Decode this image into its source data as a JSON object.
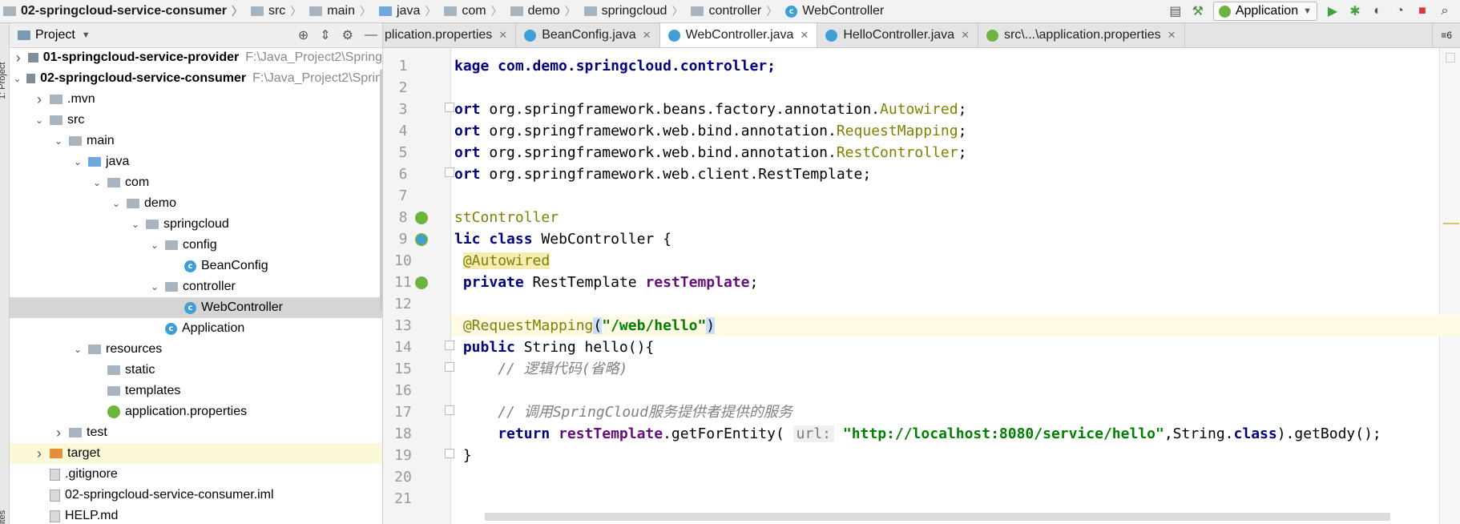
{
  "breadcrumb": [
    "02-springcloud-service-consumer",
    "src",
    "main",
    "java",
    "com",
    "demo",
    "springcloud",
    "controller",
    "WebController"
  ],
  "run_config": {
    "label": "Application"
  },
  "left_strip": {
    "top_label": "1: Project",
    "bottom_label": "ites"
  },
  "project_panel": {
    "title": "Project",
    "tree": [
      {
        "label": "01-springcloud-service-provider",
        "path": "F:\\Java_Project2\\Spring",
        "bold": true,
        "depth": 0,
        "arrow": "right",
        "icon": "module"
      },
      {
        "label": "02-springcloud-service-consumer",
        "path": "F:\\Java_Project2\\Sprin",
        "bold": true,
        "depth": 0,
        "arrow": "down",
        "icon": "module"
      },
      {
        "label": ".mvn",
        "depth": 1,
        "arrow": "right",
        "icon": "folder"
      },
      {
        "label": "src",
        "depth": 1,
        "arrow": "down",
        "icon": "folder"
      },
      {
        "label": "main",
        "depth": 2,
        "arrow": "down",
        "icon": "folder"
      },
      {
        "label": "java",
        "depth": 3,
        "arrow": "down",
        "icon": "folder-blue"
      },
      {
        "label": "com",
        "depth": 4,
        "arrow": "down",
        "icon": "folder"
      },
      {
        "label": "demo",
        "depth": 5,
        "arrow": "down",
        "icon": "folder"
      },
      {
        "label": "springcloud",
        "depth": 6,
        "arrow": "down",
        "icon": "folder"
      },
      {
        "label": "config",
        "depth": 7,
        "arrow": "down",
        "icon": "folder"
      },
      {
        "label": "BeanConfig",
        "depth": 8,
        "arrow": "",
        "icon": "class"
      },
      {
        "label": "controller",
        "depth": 7,
        "arrow": "down",
        "icon": "folder"
      },
      {
        "label": "WebController",
        "depth": 8,
        "arrow": "",
        "icon": "class",
        "selected": true
      },
      {
        "label": "Application",
        "depth": 7,
        "arrow": "",
        "icon": "class"
      },
      {
        "label": "resources",
        "depth": 3,
        "arrow": "down",
        "icon": "folder"
      },
      {
        "label": "static",
        "depth": 4,
        "arrow": "",
        "icon": "folder"
      },
      {
        "label": "templates",
        "depth": 4,
        "arrow": "",
        "icon": "folder"
      },
      {
        "label": "application.properties",
        "depth": 4,
        "arrow": "",
        "icon": "spring"
      },
      {
        "label": "test",
        "depth": 2,
        "arrow": "right",
        "icon": "folder"
      },
      {
        "label": "target",
        "depth": 1,
        "arrow": "right",
        "icon": "folder-orange",
        "highlight": true
      },
      {
        "label": ".gitignore",
        "depth": 1,
        "arrow": "",
        "icon": "file"
      },
      {
        "label": "02-springcloud-service-consumer.iml",
        "depth": 1,
        "arrow": "",
        "icon": "file"
      },
      {
        "label": "HELP.md",
        "depth": 1,
        "arrow": "",
        "icon": "file"
      }
    ]
  },
  "tabs": [
    {
      "label": "plication.properties",
      "icon": "leaf",
      "active": false
    },
    {
      "label": "BeanConfig.java",
      "icon": "class",
      "active": false
    },
    {
      "label": "WebController.java",
      "icon": "class",
      "active": true
    },
    {
      "label": "HelloController.java",
      "icon": "class",
      "active": false
    },
    {
      "label": "src\\...\\application.properties",
      "icon": "leaf",
      "active": false
    }
  ],
  "tabs_overflow": "≡6",
  "code_lines": [
    {
      "n": "1",
      "text": "kage com.demo.springcloud.controller;"
    },
    {
      "n": "2",
      "text": ""
    },
    {
      "n": "3",
      "text": "ort org.springframework.beans.factory.annotation.Autowired;"
    },
    {
      "n": "4",
      "text": "ort org.springframework.web.bind.annotation.RequestMapping;"
    },
    {
      "n": "5",
      "text": "ort org.springframework.web.bind.annotation.RestController;"
    },
    {
      "n": "6",
      "text": "ort org.springframework.web.client.RestTemplate;"
    },
    {
      "n": "7",
      "text": ""
    },
    {
      "n": "8",
      "text": "stController"
    },
    {
      "n": "9",
      "text": "lic class WebController {"
    },
    {
      "n": "10",
      "text": " @Autowired"
    },
    {
      "n": "11",
      "text": " private RestTemplate restTemplate;"
    },
    {
      "n": "12",
      "text": ""
    },
    {
      "n": "13",
      "text": " @RequestMapping(\"/web/hello\")"
    },
    {
      "n": "14",
      "text": " public String hello(){"
    },
    {
      "n": "15",
      "text": "     // 逻辑代码(省略)"
    },
    {
      "n": "16",
      "text": ""
    },
    {
      "n": "17",
      "text": "     // 调用SpringCloud服务提供者提供的服务"
    },
    {
      "n": "18",
      "text": "     return restTemplate.getForEntity( url: \"http://localhost:8080/service/hello\",String.class).getBody();"
    },
    {
      "n": "19",
      "text": " }"
    },
    {
      "n": "20",
      "text": ""
    },
    {
      "n": "21",
      "text": ""
    }
  ],
  "code_tokens": {
    "l1": "kage com.demo.springcloud.controller;",
    "imp_prefix": "ort ",
    "l3a": "org.springframework.beans.factory.annotation.",
    "l3b": "Autowired",
    "l4a": "org.springframework.web.bind.annotation.",
    "l4b": "RequestMapping",
    "l5a": "org.springframework.web.bind.annotation.",
    "l5b": "RestController",
    "l6a": "org.springframework.web.client.RestTemplate",
    "semi": ";",
    "l8": "stController",
    "l9a": "lic ",
    "l9b": "class ",
    "l9c": "WebController {",
    "l10": "@Autowired",
    "l11a": "private ",
    "l11b": "RestTemplate ",
    "l11c": "restTemplate",
    "l13a": "@RequestMapping",
    "l13b": "(",
    "l13c": "\"/web/hello\"",
    "l13d": ")",
    "l14a": "public ",
    "l14b": "String hello(){",
    "l15": "// 逻辑代码(省略)",
    "l17": "// 调用SpringCloud服务提供者提供的服务",
    "l18a": "return ",
    "l18b": "restTemplate",
    ".getForEntity(": ".getForEntity(",
    "l18c": ".getForEntity(",
    "l18hint": "url:",
    "l18str": "\"http://localhost:8080/service/hello\"",
    "l18d": ",String.",
    "l18e": "class",
    ").getBody();": ").getBody();",
    "l18f": ").getBody();",
    "l19": "}"
  },
  "colors": {
    "keyword": "#000080",
    "annotation": "#808000",
    "string": "#008000",
    "field": "#660e7a",
    "comment": "#808080"
  }
}
